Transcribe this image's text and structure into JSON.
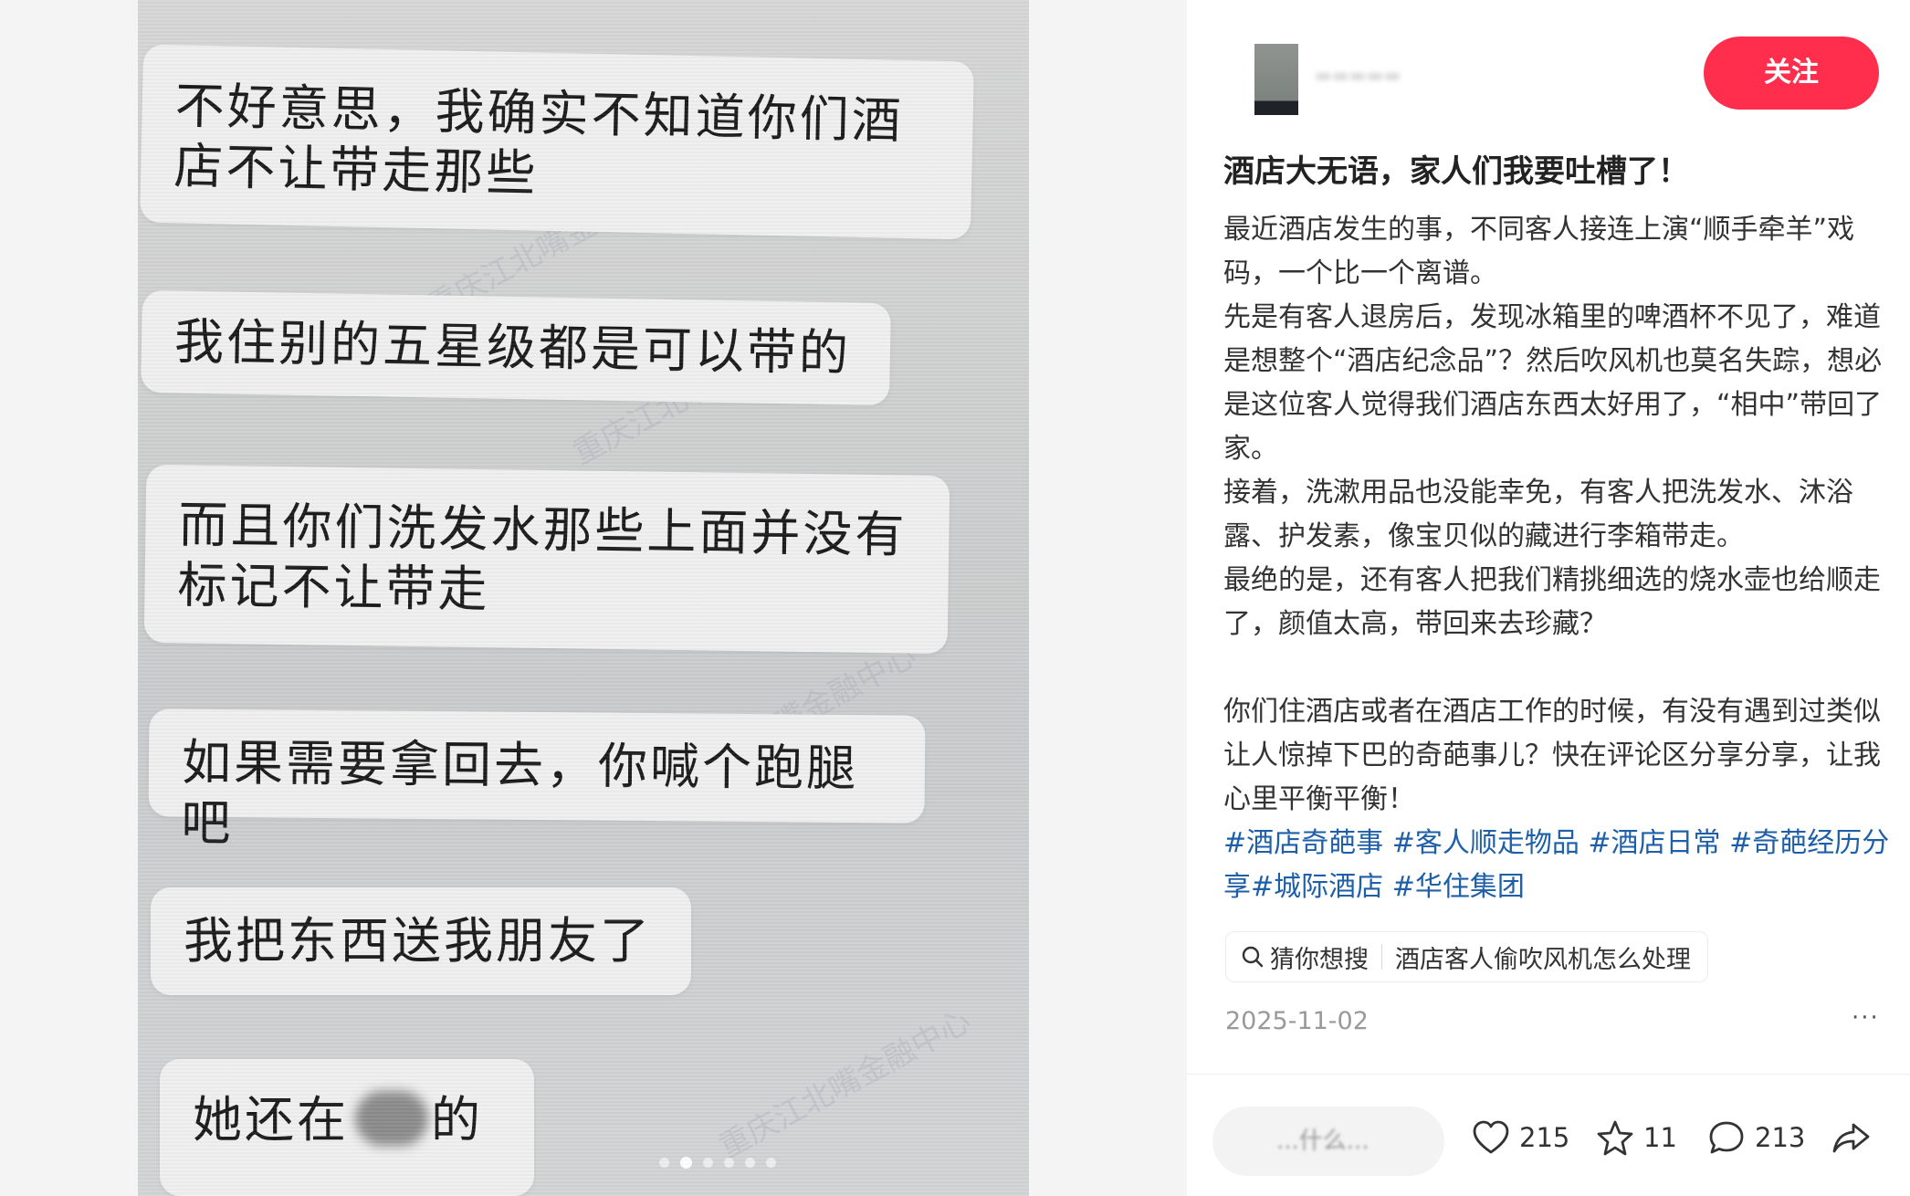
{
  "image_chat": {
    "messages": [
      "不好意思，我确实不知道你们酒店不让带走那些",
      "我住别的五星级都是可以带的",
      "而且你们洗发水那些上面并没有标记不让带走",
      "如果需要拿回去，你喊个跑腿吧",
      "我把东西送我朋友了",
      "她还在",
      "的"
    ],
    "watermark": "重庆江北嘴金融中心"
  },
  "carousel": {
    "total": 6,
    "active_index": 1
  },
  "author": {
    "follow_label": "关注"
  },
  "post": {
    "title": "酒店大无语，家人们我要吐槽了！",
    "paragraphs": [
      "最近酒店发生的事，不同客人接连上演“顺手牵羊”戏码，一个比一个离谱。",
      "先是有客人退房后，发现冰箱里的啤酒杯不见了，难道是想整个“酒店纪念品”？然后吹风机也莫名失踪，想必是这位客人觉得我们酒店东西太好用了，“相中”带回了家。",
      "接着，洗漱用品也没能幸免，有客人把洗发水、沐浴露、护发素，像宝贝似的藏进行李箱带走。",
      "最绝的是，还有客人把我们精挑细选的烧水壶也给顺走了，颜值太高，带回来去珍藏？",
      "你们住酒店或者在酒店工作的时候，有没有遇到过类似让人惊掉下巴的奇葩事儿？快在评论区分享分享，让我心里平衡平衡！"
    ],
    "tags": [
      "#酒店奇葩事",
      "#客人顺走物品",
      "#酒店日常",
      "#奇葩经历分享",
      "#城际酒店",
      "#华住集团"
    ],
    "search_label": "猜你想搜",
    "search_query": "酒店客人偷吹风机怎么处理",
    "date": "2025-11-02",
    "more": "···"
  },
  "engagement": {
    "comment_placeholder": "...什么...",
    "likes": "215",
    "favorites": "11",
    "comments": "213"
  },
  "colors": {
    "accent": "#ff2e4d",
    "tag": "#1e5fa8"
  }
}
